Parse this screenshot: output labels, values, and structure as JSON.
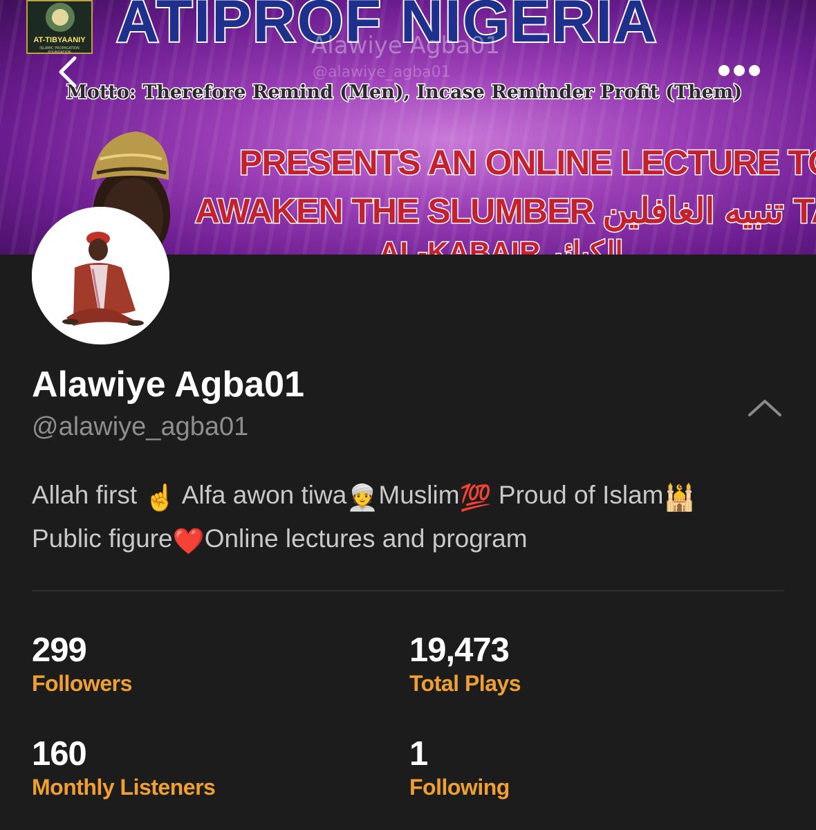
{
  "banner": {
    "logo_text": "AT-TIBYAANIY",
    "logo_subtext": "ISLAMIC PROPAGATION FOUNDATION",
    "title": "ATIPROF NIGERIA",
    "watermark_name": "Alawiye Agba01",
    "watermark_handle": "@alawiye_agba01",
    "motto": "Motto: Therefore Remind (Men), Incase Reminder Profit (Them)",
    "line1": "PRESENTS AN ONLINE LECTURE TO",
    "line2": "AWAKEN THE SLUMBER تنبيه الغافلين TAGGED",
    "line3": "AL-KABAIR الكبائر"
  },
  "nav": {
    "back_icon": "chevron-left-icon",
    "more_icon": "more-horizontal-icon"
  },
  "profile": {
    "name": "Alawiye Agba01",
    "handle": "@alawiye_agba01",
    "bio_line1": {
      "p1": "Allah first ",
      "e1": "☝️",
      "p2": " Alfa awon tiwa",
      "e2": "👳",
      "p3": "Muslim",
      "e3": "💯",
      "p4": " Proud of Islam",
      "e4": "🕌"
    },
    "bio_line2": {
      "p1": "Public figure",
      "e1": "❤️",
      "p2": "Online lectures and program"
    }
  },
  "stats": {
    "followers": {
      "value": "299",
      "label": "Followers"
    },
    "total_plays": {
      "value": "19,473",
      "label": "Total Plays"
    },
    "monthly_listeners": {
      "value": "160",
      "label": "Monthly Listeners"
    },
    "following": {
      "value": "1",
      "label": "Following"
    }
  },
  "colors": {
    "background": "#1c1c1c",
    "accent": "#f0a032",
    "handle": "#8e8e8e",
    "bio": "#c9c9c9"
  }
}
